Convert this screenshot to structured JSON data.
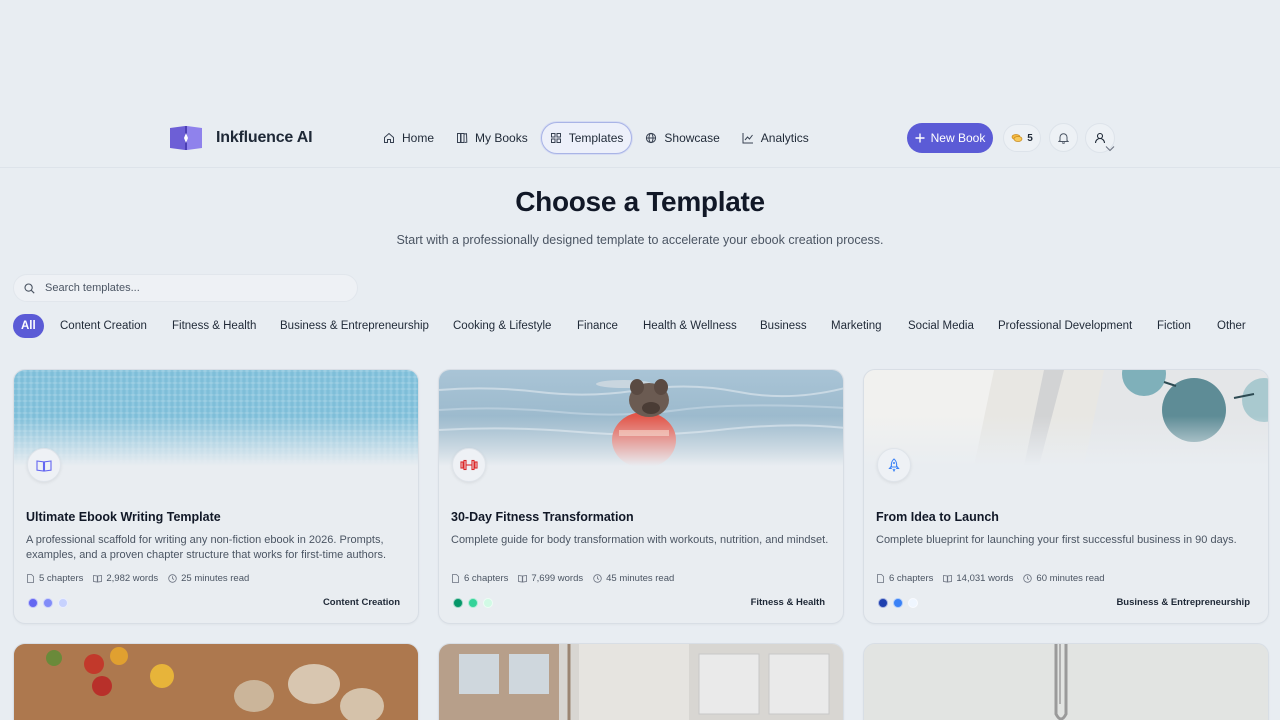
{
  "brand": {
    "name": "Inkfluence AI"
  },
  "nav": {
    "links": [
      {
        "label": "Home",
        "icon": "home-icon"
      },
      {
        "label": "My Books",
        "icon": "books-icon"
      },
      {
        "label": "Templates",
        "icon": "grid-icon",
        "active": true
      },
      {
        "label": "Showcase",
        "icon": "globe-icon"
      },
      {
        "label": "Analytics",
        "icon": "chart-icon"
      }
    ],
    "new_book": "New Book",
    "credits": "5"
  },
  "hero": {
    "title": "Choose a Template",
    "subtitle": "Start with a professionally designed template to accelerate your ebook creation process."
  },
  "search": {
    "placeholder": "Search templates..."
  },
  "categories": [
    "All",
    "Content Creation",
    "Fitness & Health",
    "Business & Entrepreneurship",
    "Cooking & Lifestyle",
    "Finance",
    "Health & Wellness",
    "Business",
    "Marketing",
    "Social Media",
    "Professional Development",
    "Fiction",
    "Other"
  ],
  "cards": [
    {
      "title": "Ultimate Ebook Writing Template",
      "description": "A professional scaffold for writing any non-fiction ebook in 2026. Prompts, examples, and a proven chapter structure that works for first-time authors.",
      "chapters": "5 chapters",
      "words": "2,982 words",
      "read": "25 minutes read",
      "category": "Content Creation",
      "icon": "book-open-icon",
      "colors": [
        "#6366f1",
        "#818cf8",
        "#c7d2fe"
      ]
    },
    {
      "title": "30-Day Fitness Transformation",
      "description": "Complete guide for body transformation with workouts, nutrition, and mindset.",
      "chapters": "6 chapters",
      "words": "7,699 words",
      "read": "45 minutes read",
      "category": "Fitness & Health",
      "icon": "dumbbell-icon",
      "colors": [
        "#059669",
        "#34d399",
        "#d1fae5"
      ]
    },
    {
      "title": "From Idea to Launch",
      "description": "Complete blueprint for launching your first successful business in 90 days.",
      "chapters": "6 chapters",
      "words": "14,031 words",
      "read": "60 minutes read",
      "category": "Business & Entrepreneurship",
      "icon": "rocket-icon",
      "colors": [
        "#1e40af",
        "#3b82f6",
        "#eff6ff"
      ]
    }
  ]
}
